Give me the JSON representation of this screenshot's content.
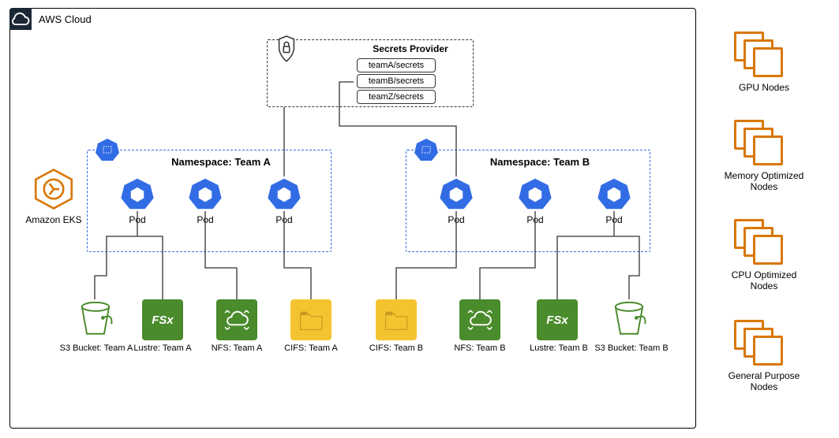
{
  "cloud": {
    "label": "AWS Cloud"
  },
  "secrets": {
    "title": "Secrets Provider",
    "items": [
      "teamA/secrets",
      "teamB/secrets",
      "teamZ/secrets"
    ]
  },
  "eks": {
    "label": "Amazon EKS"
  },
  "teamA": {
    "title": "Namespace: Team A",
    "pods": [
      "Pod",
      "Pod",
      "Pod"
    ],
    "storage": {
      "s3": "S3 Bucket: Team A",
      "lustre": "Lustre: Team A",
      "nfs": "NFS: Team A",
      "cifs": "CIFS: Team A"
    }
  },
  "teamB": {
    "title": "Namespace: Team B",
    "pods": [
      "Pod",
      "Pod",
      "Pod"
    ],
    "storage": {
      "s3": "S3 Bucket: Team B",
      "lustre": "Lustre: Team B",
      "nfs": "NFS: Team B",
      "cifs": "CIFS: Team B"
    }
  },
  "nodeGroups": {
    "gpu": "GPU Nodes",
    "mem": "Memory Optimized Nodes",
    "cpu": "CPU Optimized Nodes",
    "gp": "General Purpose Nodes"
  },
  "fsx_text": "FSx"
}
